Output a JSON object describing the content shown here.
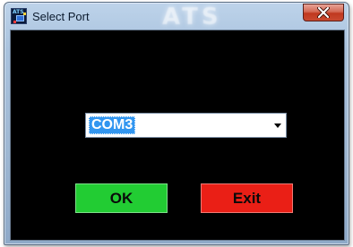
{
  "window": {
    "title": "Select Port",
    "background_label": "ATS",
    "app_icon_text": "ATS"
  },
  "port_select": {
    "selected": "COM3"
  },
  "buttons": {
    "ok_label": "OK",
    "exit_label": "Exit"
  },
  "colors": {
    "ok": "#22cc33",
    "exit": "#ea1f16",
    "selection": "#3296f0",
    "client_bg": "#000000"
  },
  "icons": {
    "app": "ats-app-icon",
    "close": "close-icon",
    "dropdown": "chevron-down-icon"
  }
}
